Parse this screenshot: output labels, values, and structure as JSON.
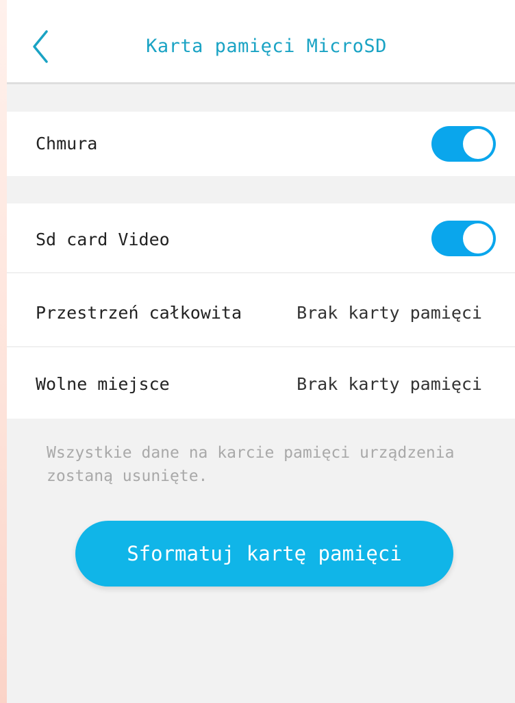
{
  "header": {
    "title": "Karta pamięci MicroSD",
    "back_icon": "chevron-left-icon"
  },
  "colors": {
    "accent": "#1aa3c4",
    "toggle_on": "#0aa6ec",
    "button": "#10b5e8",
    "background": "#f2f2f2"
  },
  "cloud": {
    "label": "Chmura",
    "enabled": true
  },
  "sd_video": {
    "label": "Sd card Video",
    "enabled": true
  },
  "storage": {
    "total_label": "Przestrzeń całkowita",
    "total_value": "Brak karty pamięci",
    "free_label": "Wolne miejsce",
    "free_value": "Brak karty pamięci"
  },
  "notice": "Wszystkie dane na karcie pamięci urządzenia\nzostaną usunięte.",
  "format_button": {
    "label": "Sformatuj kartę pamięci"
  }
}
